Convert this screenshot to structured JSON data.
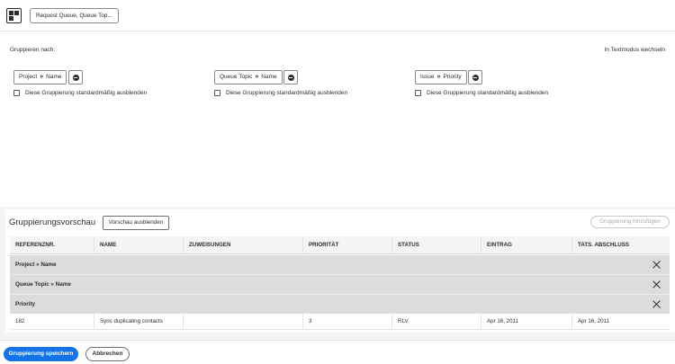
{
  "header": {
    "title_button": "Request Queue, Queue Top..."
  },
  "grouping": {
    "label": "Gruppieren nach:",
    "text_mode_link": "In Textmodus wechseln",
    "hide_default_label": "Diese Gruppierung standardmäßig ausblenden",
    "groups": [
      {
        "first": "Project",
        "second": "Name"
      },
      {
        "first": "Queue Topic",
        "second": "Name"
      },
      {
        "first": "Issue",
        "second": "Priority"
      }
    ]
  },
  "preview": {
    "title": "Gruppierungsvorschau",
    "hide_button": "Vorschau ausblenden",
    "add_button": "Gruppierung hinzufügen",
    "columns": [
      "REFERENZNR.",
      "NAME",
      "ZUWEISUNGEN",
      "PRIORITÄT",
      "STATUS",
      "EINTRAG",
      "TATS. ABSCHLUSS"
    ],
    "group_rows": [
      "Project » Name",
      "Queue Topic » Name",
      "Priority"
    ],
    "rows": [
      {
        "ref": "182",
        "name": "Sync duplicating contacts",
        "assign": "",
        "priority": "3",
        "status": "RLV",
        "entry": "Apr 16, 2011",
        "done": "Apr 16, 2011"
      }
    ]
  },
  "footer": {
    "save_button": "Gruppierung speichern",
    "cancel_button": "Abbrechen"
  },
  "colors": {
    "primary": "#1473e6",
    "group_row_bg": "#dcdcdc"
  }
}
